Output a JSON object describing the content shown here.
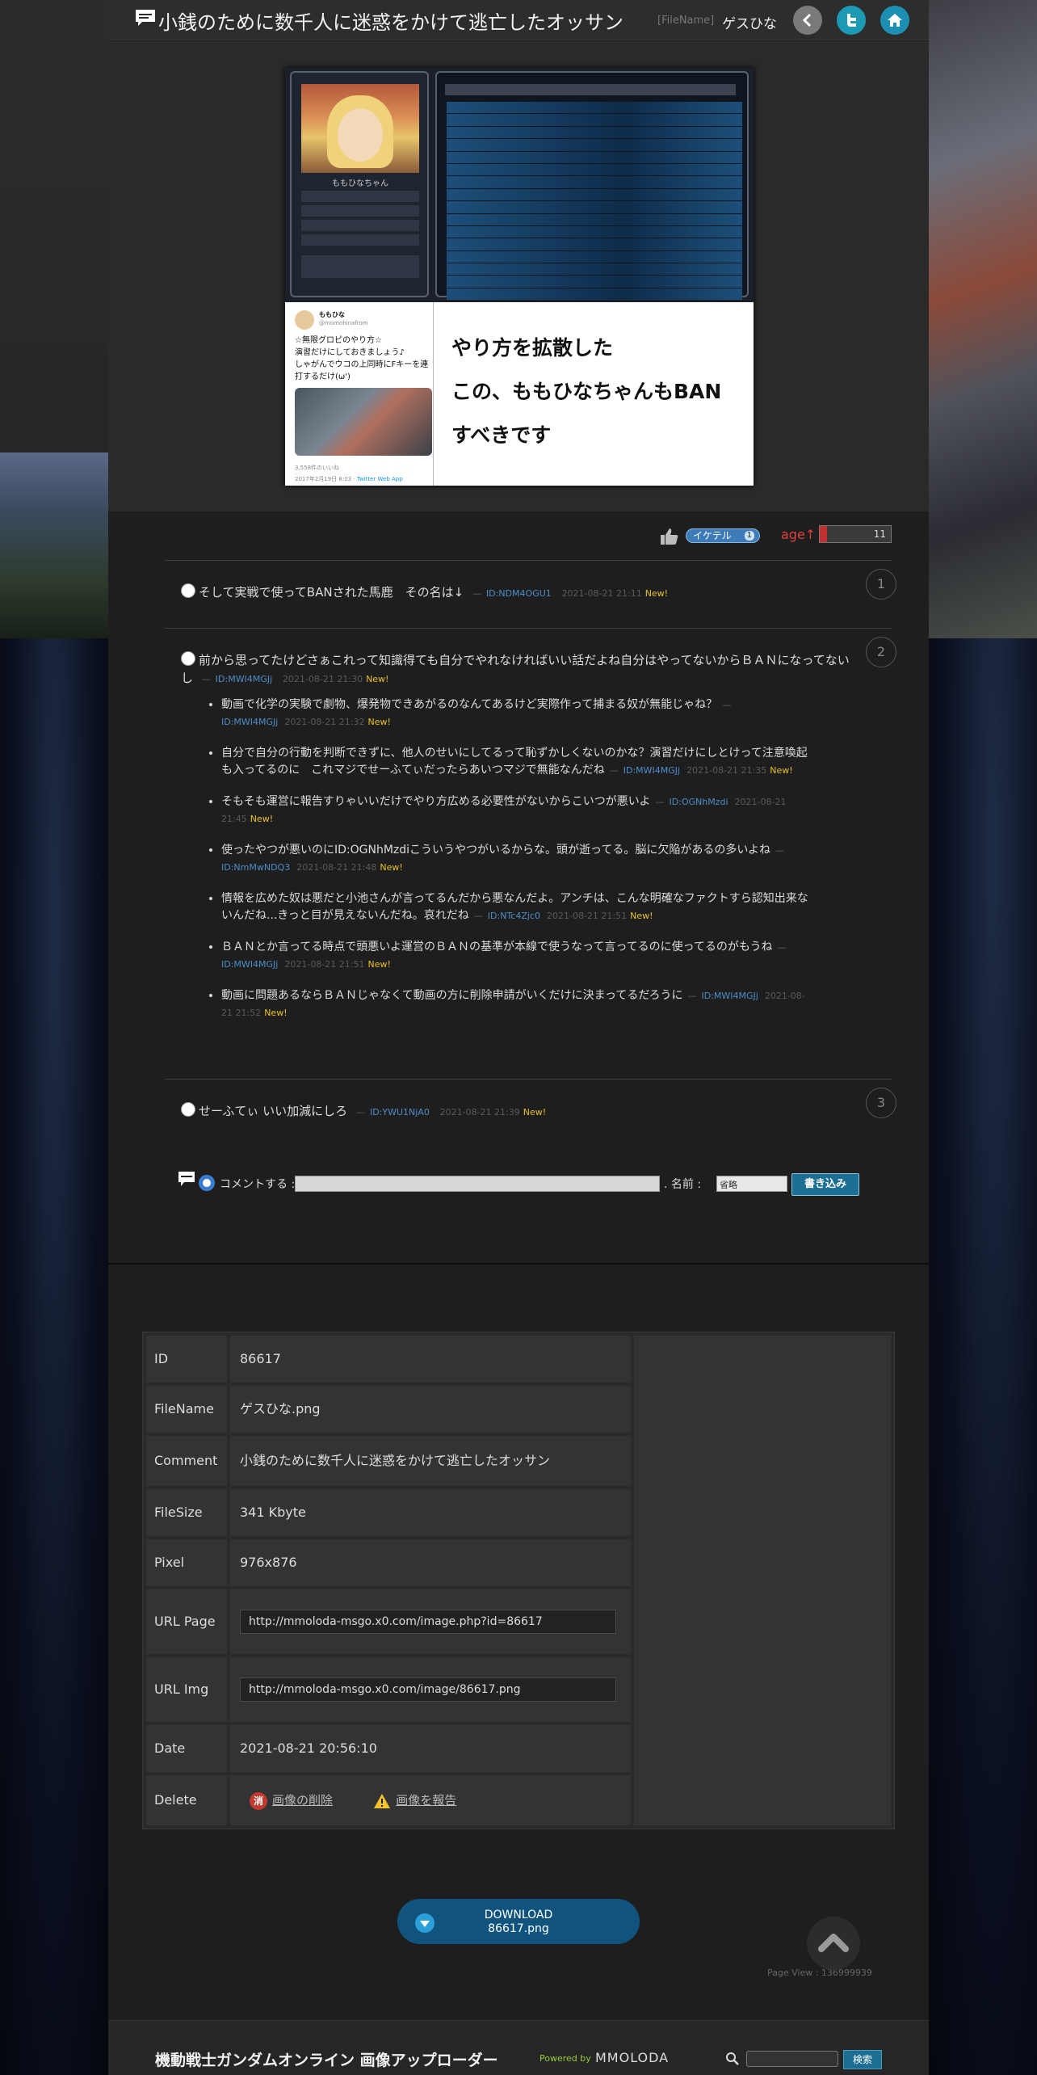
{
  "header": {
    "title": "小銭のために数千人に迷惑をかけて逃亡したオッサン",
    "filename_tag": "[FileName]",
    "filename": "ゲスひな"
  },
  "image": {
    "profile_name": "ももひなちゃん",
    "tweet_name": "ももひな",
    "tweet_handle": "@momohinafrom",
    "tweet_text": "☆無限グロピのやり方☆\n演習だけにしておきましょう♪\nしゃがんでウコの上同時にFキーを連打するだけ(ω')",
    "tweet_meta": "3,558件のいいね",
    "tweet_date": "2017年2月19日 8:03",
    "tweet_app": "Twitter Web App",
    "overlay_lines": [
      "やり方を拡散した",
      "この、ももひなちゃんもBAN",
      "すべきです"
    ]
  },
  "rating": {
    "like_label": "イケテル",
    "like_count": "1",
    "age_label": "age↑",
    "age_count": "11",
    "age_level": 0.1
  },
  "comments": [
    {
      "number": "1",
      "text": "そして実戦で使ってBANされた馬鹿　その名は↓",
      "id": "ID:NDM4OGU1",
      "date": "2021-08-21 21:11",
      "new": "New!",
      "replies": []
    },
    {
      "number": "2",
      "text": "前から思ってたけどさぁこれって知識得ても自分でやれなければいい話だよね自分はやってないからＢＡＮになってないし",
      "id": "ID:MWI4MGJj",
      "date": "2021-08-21 21:30",
      "new": "New!",
      "replies": [
        {
          "text": "動画で化学の実験で劇物、爆発物できあがるのなんてあるけど実際作って捕まる奴が無能じゃね？",
          "id": "ID:MWI4MGJj",
          "date": "2021-08-21 21:32",
          "new": "New!"
        },
        {
          "text": "自分で自分の行動を判断できずに、他人のせいにしてるって恥ずかしくないのかな？演習だけにしとけって注意喚起も入ってるのに　これマジでせーふてぃだったらあいつマジで無能なんだね",
          "id": "ID:MWI4MGJj",
          "date": "2021-08-21 21:35",
          "new": "New!"
        },
        {
          "text": "そもそも運営に報告すりゃいいだけでやり方広める必要性がないからこいつが悪いよ",
          "id": "ID:OGNhMzdi",
          "date": "2021-08-21 21:45",
          "new": "New!"
        },
        {
          "text": "使ったやつが悪いのにID:OGNhMzdiこういうやつがいるからな。頭が逝ってる。脳に欠陥があるの多いよね",
          "id": "ID:NmMwNDQ3",
          "date": "2021-08-21 21:48",
          "new": "New!"
        },
        {
          "text": "情報を広めた奴は悪だと小池さんが言ってるんだから悪なんだよ。アンチは、こんな明確なファクトすら認知出来ないんだね...きっと目が見えないんだね。哀れだね",
          "id": "ID:NTc4Zjc0",
          "date": "2021-08-21 21:51",
          "new": "New!"
        },
        {
          "text": "ＢＡＮとか言ってる時点で頭悪いよ運営のＢＡＮの基準が本線で使うなって言ってるのに使ってるのがもうね",
          "id": "ID:MWI4MGJj",
          "date": "2021-08-21 21:51",
          "new": "New!"
        },
        {
          "text": "動画に問題あるならＢＡＮじゃなくて動画の方に削除申請がいくだけに決まってるだろうに",
          "id": "ID:MWI4MGJj",
          "date": "2021-08-21 21:52",
          "new": "New!"
        }
      ]
    },
    {
      "number": "3",
      "text": "せーふてぃ いい加減にしろ",
      "id": "ID:YWU1NjA0",
      "date": "2021-08-21 21:39",
      "new": "New!",
      "replies": []
    }
  ],
  "form": {
    "comment_label": "コメントする :",
    "name_label": ". 名前 :",
    "name_value": "省略",
    "submit_label": "書き込み"
  },
  "info": {
    "rows": [
      {
        "key": "ID",
        "value": "86617"
      },
      {
        "key": "FileName",
        "value": "ゲスひな.png"
      },
      {
        "key": "Comment",
        "value": "小銭のために数千人に迷惑をかけて逃亡したオッサン"
      },
      {
        "key": "FileSize",
        "value": "341 Kbyte"
      },
      {
        "key": "Pixel",
        "value": "976x876"
      },
      {
        "key": "URL Page",
        "value": "http://mmoloda-msgo.x0.com/image.php?id=86617"
      },
      {
        "key": "URL Img",
        "value": "http://mmoloda-msgo.x0.com/image/86617.png"
      },
      {
        "key": "Date",
        "value": "2021-08-21 20:56:10"
      },
      {
        "key": "Delete",
        "value": ""
      }
    ],
    "delete_icon_text": "消",
    "delete_label": "画像の削除",
    "report_label": "画像を報告"
  },
  "download": {
    "line1": "DOWNLOAD",
    "line2": "86617.png"
  },
  "page_view": "Page View : 136999939",
  "footer": {
    "title": "機動戦士ガンダムオンライン 画像アップローダー",
    "powered": "Powered by",
    "brand": "MMOLODA",
    "search_label": "検索"
  },
  "colors": {
    "accent": "#1c6e93",
    "id_link": "#4d8dc9",
    "new_badge": "#e8c12b",
    "age": "#e04040"
  }
}
